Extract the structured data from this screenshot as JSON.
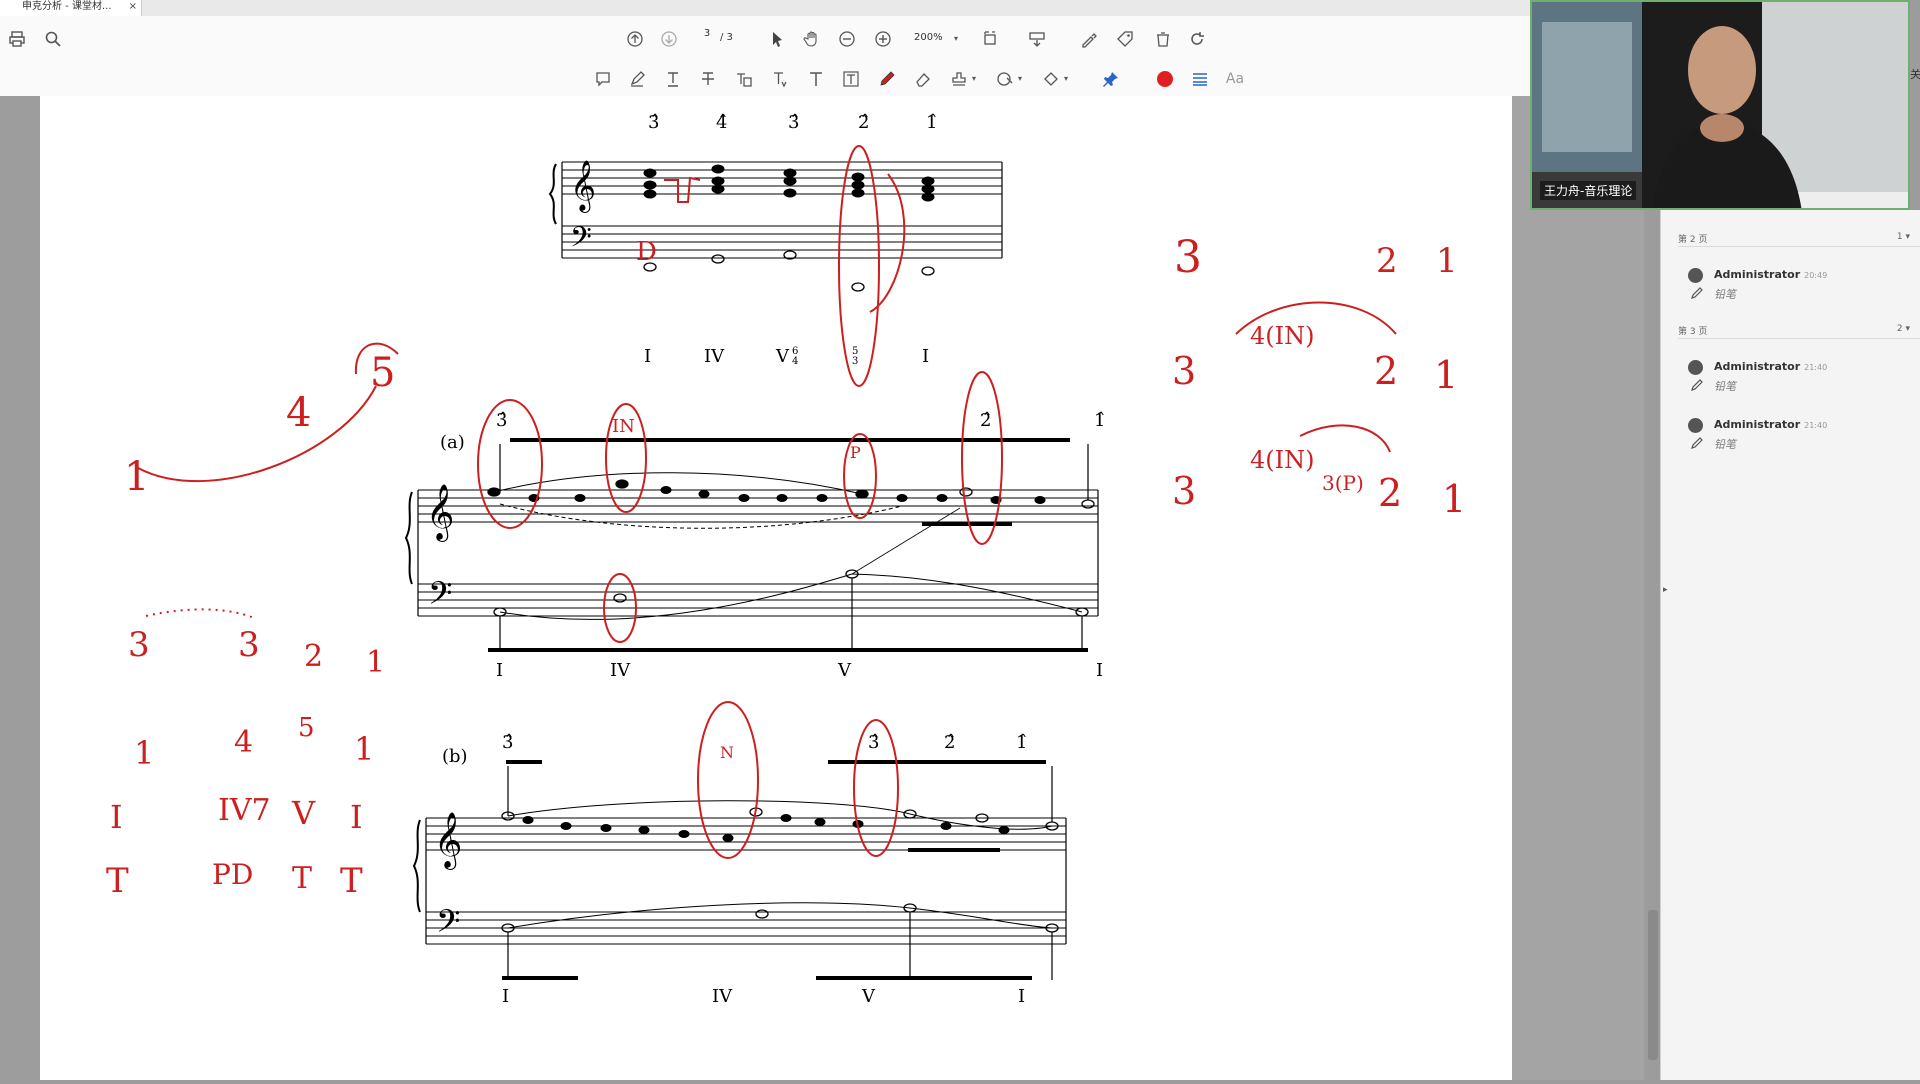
{
  "tab": {
    "title": "申克分析 - 课堂材...",
    "close": "×"
  },
  "toolbar": {
    "page_current": "3",
    "page_total": "/ 3",
    "zoom": "200%"
  },
  "score": {
    "sys1_degrees": [
      "3̂",
      "4̂",
      "3̂",
      "2̂",
      "1̂"
    ],
    "sys1_roman": [
      "I",
      "IV",
      "V",
      "I"
    ],
    "sys1_figures": [
      "6",
      "4",
      "5",
      "3"
    ],
    "sys2_label": "(a)",
    "sys2_degrees": [
      "3̂",
      "2̂",
      "1̂"
    ],
    "sys2_roman": [
      "I",
      "IV",
      "V",
      "I"
    ],
    "sys3_label": "(b)",
    "sys3_degrees": [
      "3̂",
      "3̂",
      "2̂",
      "1̂"
    ],
    "sys3_roman": [
      "I",
      "IV",
      "V",
      "I"
    ],
    "ink_left": [
      "1",
      "4",
      "5",
      "3",
      "3",
      "2",
      "1",
      "1",
      "4",
      "5",
      "1",
      "I",
      "IV7",
      "V",
      "I",
      "T",
      "PD",
      "D",
      "T",
      "T",
      "IN",
      "P",
      "N"
    ],
    "ink_right": [
      "3",
      "2",
      "1",
      "3",
      "4(IN)",
      "2",
      "1",
      "3",
      "4(IN)",
      "3(P)",
      "2",
      "1"
    ]
  },
  "webcam": {
    "name": "王力舟-音乐理论"
  },
  "comments": {
    "sections": [
      {
        "label": "第 2 页",
        "count": "1 ▾"
      },
      {
        "label": "第 3 页",
        "count": "2 ▾"
      }
    ],
    "items": [
      {
        "author": "Administrator",
        "time": "20:49",
        "type": "铅笔"
      },
      {
        "author": "Administrator",
        "time": "21:40",
        "type": "铅笔"
      },
      {
        "author": "Administrator",
        "time": "21:40",
        "type": "铅笔"
      }
    ]
  },
  "edge": {
    "text": "关"
  },
  "colors": {
    "ink": "#cc1f1f",
    "page": "#ffffff",
    "gutter": "#9c9c9c"
  }
}
